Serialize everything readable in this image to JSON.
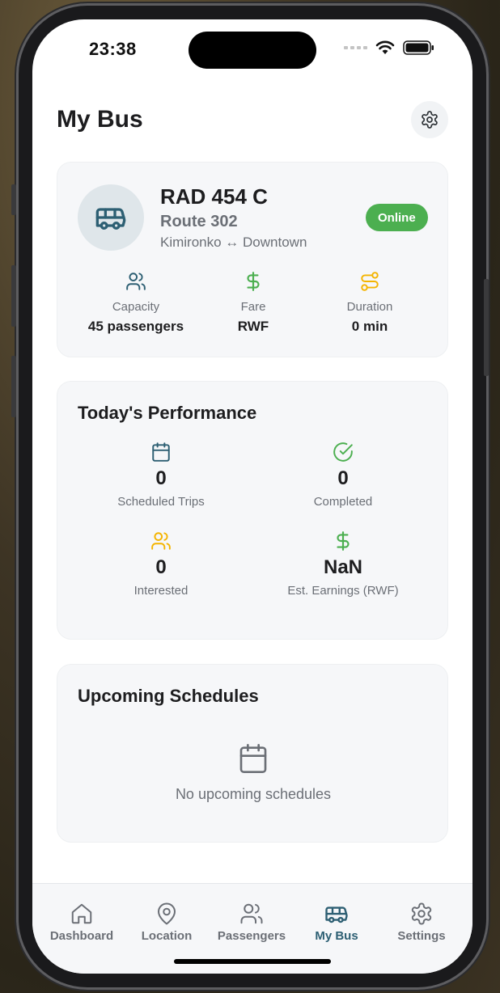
{
  "status_bar": {
    "time": "23:38"
  },
  "header": {
    "title": "My Bus"
  },
  "bus": {
    "plate": "RAD 454 C",
    "route": "Route 302",
    "path": "Kimironko ↔ Downtown",
    "status": "Online",
    "stats": [
      {
        "icon": "users-icon",
        "label": "Capacity",
        "value": "45 passengers",
        "color": "#2d5f73"
      },
      {
        "icon": "dollar-icon",
        "label": "Fare",
        "value": "RWF",
        "color": "#4caf50"
      },
      {
        "icon": "route-icon",
        "label": "Duration",
        "value": "0 min",
        "color": "#f4b400"
      }
    ]
  },
  "performance": {
    "title": "Today's Performance",
    "metrics": [
      {
        "icon": "calendar-icon",
        "value": "0",
        "label": "Scheduled Trips",
        "color": "#2d5f73"
      },
      {
        "icon": "check-circle-icon",
        "value": "0",
        "label": "Completed",
        "color": "#4caf50"
      },
      {
        "icon": "users-icon",
        "value": "0",
        "label": "Interested",
        "color": "#f4b400"
      },
      {
        "icon": "dollar-icon",
        "value": "NaN",
        "label": "Est. Earnings (RWF)",
        "color": "#4caf50"
      }
    ]
  },
  "upcoming": {
    "title": "Upcoming Schedules",
    "empty_text": "No upcoming schedules"
  },
  "tabs": [
    {
      "label": "Dashboard",
      "icon": "home-icon",
      "active": false
    },
    {
      "label": "Location",
      "icon": "location-pin-icon",
      "active": false
    },
    {
      "label": "Passengers",
      "icon": "users-icon",
      "active": false
    },
    {
      "label": "My Bus",
      "icon": "bus-icon",
      "active": true
    },
    {
      "label": "Settings",
      "icon": "gear-icon",
      "active": false
    }
  ],
  "colors": {
    "primary": "#2d5f73",
    "success": "#4caf50",
    "warning": "#f4b400",
    "muted_text": "#6b6f76"
  }
}
